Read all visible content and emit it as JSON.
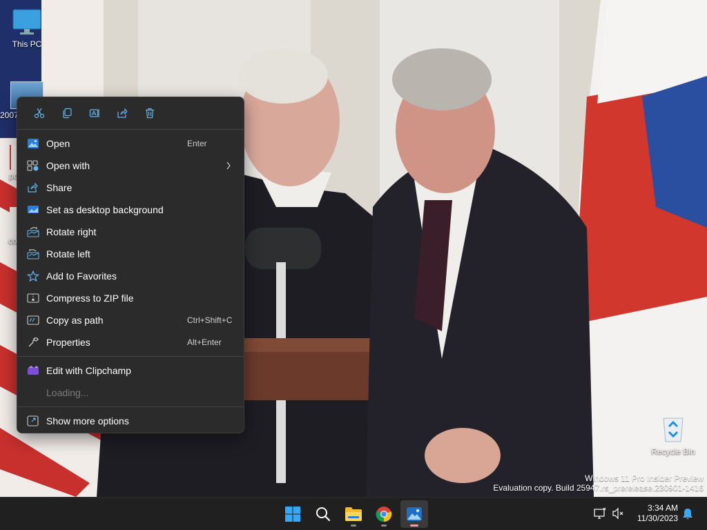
{
  "desktop": {
    "icons": [
      {
        "label": "This PC",
        "icon": "monitor-icon"
      },
      {
        "label": "2007",
        "icon": "image-file-icon"
      },
      {
        "label": "po",
        "icon": "document-icon"
      },
      {
        "label": "co",
        "icon": "document-icon"
      },
      {
        "label": "Recycle Bin",
        "icon": "recycle-bin-icon"
      }
    ]
  },
  "context_menu": {
    "toolbar": [
      {
        "name": "cut",
        "icon": "scissors-icon"
      },
      {
        "name": "copy",
        "icon": "copy-icon"
      },
      {
        "name": "rename",
        "icon": "rename-icon"
      },
      {
        "name": "share",
        "icon": "share-icon"
      },
      {
        "name": "delete",
        "icon": "trash-icon"
      }
    ],
    "items": [
      {
        "label": "Open",
        "accelerator": "Enter",
        "icon": "photos-icon"
      },
      {
        "label": "Open with",
        "accelerator": "",
        "icon": "open-with-icon",
        "submenu": true
      },
      {
        "label": "Share",
        "accelerator": "",
        "icon": "share-icon"
      },
      {
        "label": "Set as desktop background",
        "accelerator": "",
        "icon": "desktop-background-icon"
      },
      {
        "label": "Rotate right",
        "accelerator": "",
        "icon": "rotate-right-icon"
      },
      {
        "label": "Rotate left",
        "accelerator": "",
        "icon": "rotate-left-icon"
      },
      {
        "label": "Add to Favorites",
        "accelerator": "",
        "icon": "star-icon"
      },
      {
        "label": "Compress to ZIP file",
        "accelerator": "",
        "icon": "zip-icon"
      },
      {
        "label": "Copy as path",
        "accelerator": "Ctrl+Shift+C",
        "icon": "copy-path-icon"
      },
      {
        "label": "Properties",
        "accelerator": "Alt+Enter",
        "icon": "wrench-icon"
      }
    ],
    "extra_items": [
      {
        "label": "Edit with Clipchamp",
        "icon": "clipchamp-icon"
      },
      {
        "label": "Loading...",
        "icon": ""
      }
    ],
    "more_options": {
      "label": "Show more options",
      "icon": "show-more-icon"
    }
  },
  "watermark": {
    "line1": "Windows 11 Pro Insider Preview",
    "line2": "Evaluation copy. Build 25947.rs_prerelease.230901-1416"
  },
  "taskbar": {
    "apps": [
      {
        "name": "start",
        "icon": "windows-start-icon"
      },
      {
        "name": "search",
        "icon": "search-icon"
      },
      {
        "name": "file-explorer",
        "icon": "folder-icon"
      },
      {
        "name": "chrome",
        "icon": "chrome-icon"
      },
      {
        "name": "photos",
        "icon": "photos-icon",
        "active": true
      }
    ],
    "clock": {
      "time": "3:34 AM",
      "date": "11/30/2023"
    }
  },
  "colors": {
    "menu_bg": "#2b2b2b",
    "taskbar_bg": "#202020",
    "accent": "#4cc2ff"
  }
}
